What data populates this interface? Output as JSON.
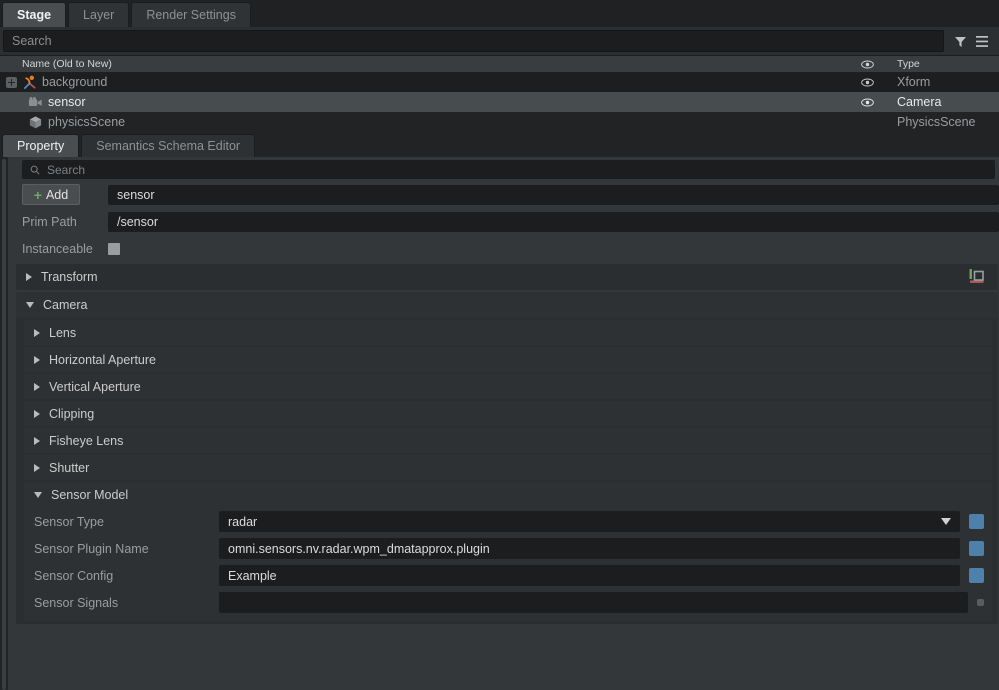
{
  "stage": {
    "tabs": [
      {
        "label": "Stage",
        "active": true
      },
      {
        "label": "Layer",
        "active": false
      },
      {
        "label": "Render Settings",
        "active": false
      }
    ],
    "search_placeholder": "Search",
    "filter_icon": "filter-funnel-icon",
    "menu_icon": "hamburger-menu-icon",
    "columns": {
      "name": "Name (Old to New)",
      "eye": "visibility-icon",
      "type": "Type"
    },
    "rows": [
      {
        "name": "background",
        "type": "Xform",
        "icon": "xform-axis-icon",
        "eye": true,
        "expandable": true,
        "depth": 0,
        "selected": false
      },
      {
        "name": "sensor",
        "type": "Camera",
        "icon": "camera-icon",
        "eye": true,
        "expandable": false,
        "depth": 1,
        "selected": true
      },
      {
        "name": "physicsScene",
        "type": "PhysicsScene",
        "icon": "cube-icon",
        "eye": false,
        "expandable": false,
        "depth": 1,
        "selected": false
      }
    ]
  },
  "property": {
    "tabs": [
      {
        "label": "Property",
        "active": true
      },
      {
        "label": "Semantics Schema Editor",
        "active": false
      }
    ],
    "search_placeholder": "Search",
    "add_label": "Add",
    "prim_name": "sensor",
    "prim_path_label": "Prim Path",
    "prim_path_value": "/sensor",
    "instanceable_label": "Instanceable",
    "instanceable_checked": false,
    "transform": {
      "label": "Transform",
      "expanded": false,
      "gizmo_icon": "axis-gizmo-icon"
    },
    "camera": {
      "label": "Camera",
      "expanded": true,
      "subsections": [
        {
          "label": "Lens",
          "expanded": false
        },
        {
          "label": "Horizontal Aperture",
          "expanded": false
        },
        {
          "label": "Vertical Aperture",
          "expanded": false
        },
        {
          "label": "Clipping",
          "expanded": false
        },
        {
          "label": "Fisheye Lens",
          "expanded": false
        },
        {
          "label": "Shutter",
          "expanded": false
        }
      ]
    },
    "sensor_model": {
      "label": "Sensor Model",
      "expanded": true,
      "fields": [
        {
          "label": "Sensor Type",
          "value": "radar",
          "dropdown": true,
          "badge": "#4d80ab"
        },
        {
          "label": "Sensor Plugin Name",
          "value": "omni.sensors.nv.radar.wpm_dmatapprox.plugin",
          "dropdown": false,
          "badge": "#4d80ab"
        },
        {
          "label": "Sensor Config",
          "value": "Example",
          "dropdown": false,
          "badge": "#4d80ab"
        },
        {
          "label": "Sensor Signals",
          "value": "",
          "dropdown": false,
          "badge": "small"
        }
      ]
    }
  }
}
